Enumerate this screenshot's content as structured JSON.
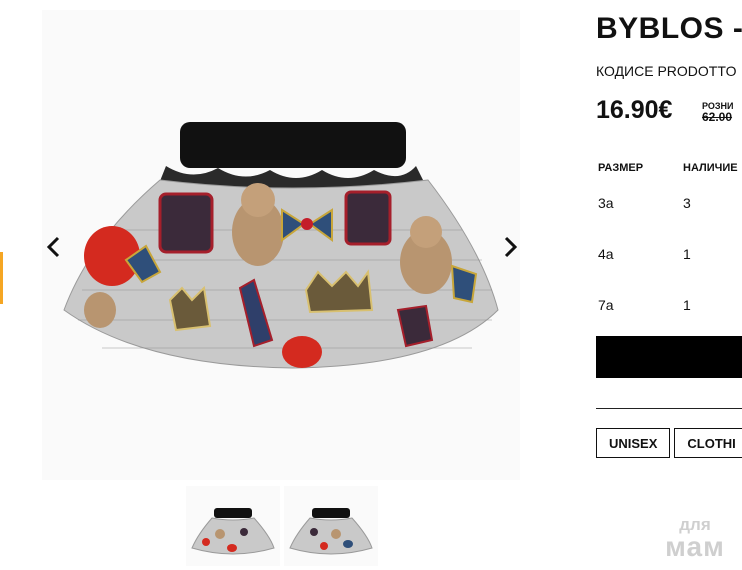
{
  "product": {
    "title": "BYBLOS - ",
    "code_label": "КОДИCE PRODOTTO",
    "price": "16.90€",
    "retail_label": "РОЗНИ",
    "old_price": "62.00"
  },
  "sizes_table": {
    "headers": [
      "РАЗМЕР",
      "НАЛИЧИЕ"
    ],
    "rows": [
      {
        "size": "3a",
        "qty": "3"
      },
      {
        "size": "4a",
        "qty": "1"
      },
      {
        "size": "7a",
        "qty": "1"
      }
    ]
  },
  "tags": [
    "UNISEX",
    "CLOTHI"
  ],
  "watermark": {
    "top": "для",
    "bottom": "мам"
  },
  "icons": {
    "prev": "chevron-left-icon",
    "next": "chevron-right-icon"
  },
  "colors": {
    "button": "#000000",
    "accent": "#f5a623"
  }
}
